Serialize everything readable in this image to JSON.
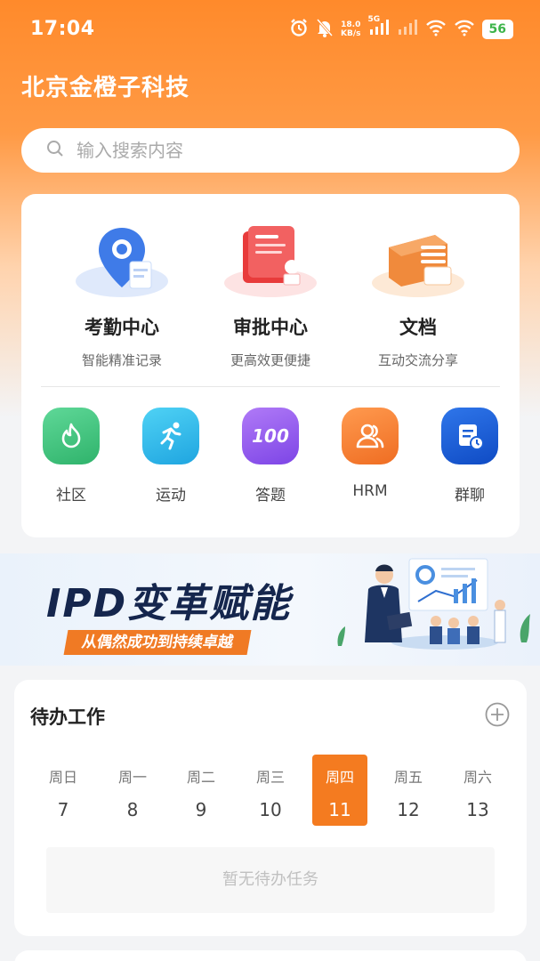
{
  "status_bar": {
    "time": "17:04",
    "net_speed_value": "18.0",
    "net_speed_unit": "KB/s",
    "signal_label": "5G",
    "battery": "56",
    "icons": [
      "alarm-icon",
      "bell-muted-icon",
      "signal-icon",
      "signal-weak-icon",
      "wifi-icon",
      "wifi-icon-2",
      "battery-icon"
    ]
  },
  "header": {
    "title": "北京金橙子科技"
  },
  "search": {
    "placeholder": "输入搜索内容",
    "icon": "search-icon"
  },
  "main_features": [
    {
      "label": "考勤中心",
      "subtitle": "智能精准记录",
      "icon": "location-pin-icon"
    },
    {
      "label": "审批中心",
      "subtitle": "更高效更便捷",
      "icon": "approval-stamp-icon"
    },
    {
      "label": "文档",
      "subtitle": "互动交流分享",
      "icon": "document-stack-icon"
    }
  ],
  "quick_apps": [
    {
      "label": "社区",
      "icon": "flame-icon",
      "color": "#3cc47a"
    },
    {
      "label": "运动",
      "icon": "running-person-icon",
      "color": "#27b6e8"
    },
    {
      "label": "答题",
      "icon": "score-100-icon",
      "color": "#9a5cf0",
      "icon_text": "100"
    },
    {
      "label": "HRM",
      "icon": "people-icon",
      "color": "#f27a2c"
    },
    {
      "label": "群聊",
      "icon": "chat-doc-icon",
      "color": "#1b5fd6"
    }
  ],
  "banner": {
    "title": "IPD变革赋能",
    "subtitle": "从偶然成功到持续卓越"
  },
  "todo": {
    "title": "待办工作",
    "add_icon": "plus-circle-icon",
    "week": [
      {
        "name": "周日",
        "day": "7",
        "active": false
      },
      {
        "name": "周一",
        "day": "8",
        "active": false
      },
      {
        "name": "周二",
        "day": "9",
        "active": false
      },
      {
        "name": "周三",
        "day": "10",
        "active": false
      },
      {
        "name": "周四",
        "day": "11",
        "active": true
      },
      {
        "name": "周五",
        "day": "12",
        "active": false
      },
      {
        "name": "周六",
        "day": "13",
        "active": false
      }
    ],
    "empty_text": "暂无待办任务"
  },
  "colors": {
    "brand": "#ff8a2b",
    "active_day": "#f47b20"
  }
}
